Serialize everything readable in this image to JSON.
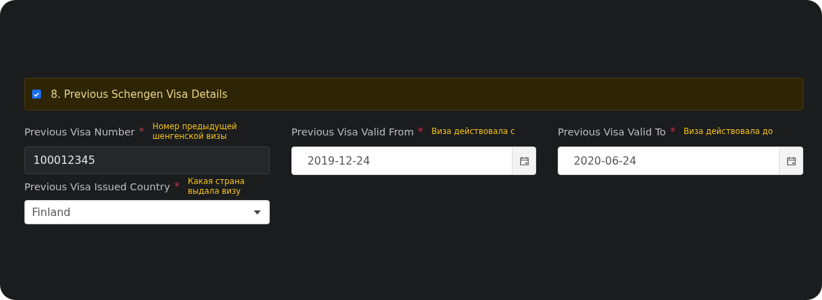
{
  "section": {
    "checked": true,
    "title": "8. Previous Schengen Visa Details"
  },
  "fields": [
    {
      "kind": "text",
      "label": "Previous Visa Number",
      "required_mark": "*",
      "hint": "Номер предыдущей шенгенской визы",
      "value": "100012345"
    },
    {
      "kind": "date",
      "label": "Previous Visa Valid From",
      "required_mark": "*",
      "hint": "Виза действовала с",
      "value": "2019-12-24"
    },
    {
      "kind": "date",
      "label": "Previous Visa Valid To",
      "required_mark": "*",
      "hint": "Виза действовала до",
      "value": "2020-06-24"
    },
    {
      "kind": "select",
      "label": "Previous Visa Issued Country",
      "required_mark": "*",
      "hint": "Какая страна выдала визу",
      "value": "Finland"
    }
  ]
}
